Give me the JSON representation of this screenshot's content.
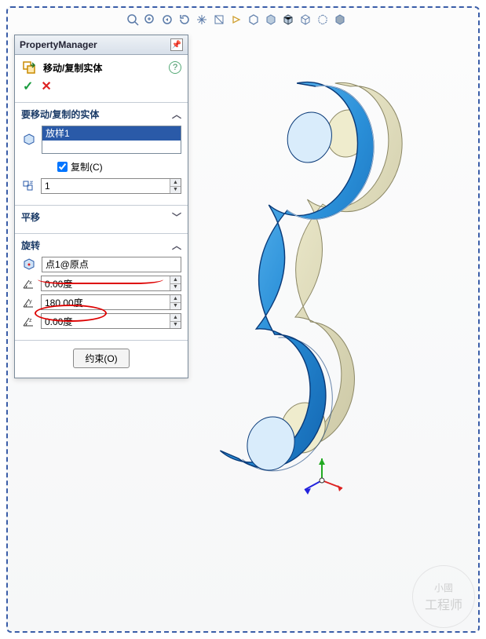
{
  "panel_title": "PropertyManager",
  "command": {
    "title": "移动/复制实体",
    "icon": "move-copy-body-icon"
  },
  "actions": {
    "ok": "✓",
    "cancel": "✕",
    "help": "?"
  },
  "section_bodies": {
    "title": "要移动/复制的实体",
    "selected_item": "放样1",
    "copy_label": "复制(C)",
    "copy_checked": true,
    "count_value": "1"
  },
  "section_translate": {
    "title": "平移",
    "collapsed": true
  },
  "section_rotate": {
    "title": "旋转",
    "ref_value": "点1@原点",
    "x_value": "0.00度",
    "y_value": "180.00度",
    "z_value": "0.00度"
  },
  "constraint_button": "约束(O)",
  "watermark": {
    "line1": "小國",
    "line2": "工程师"
  },
  "highlights": {
    "ref_circled": true,
    "y_circled": true
  }
}
